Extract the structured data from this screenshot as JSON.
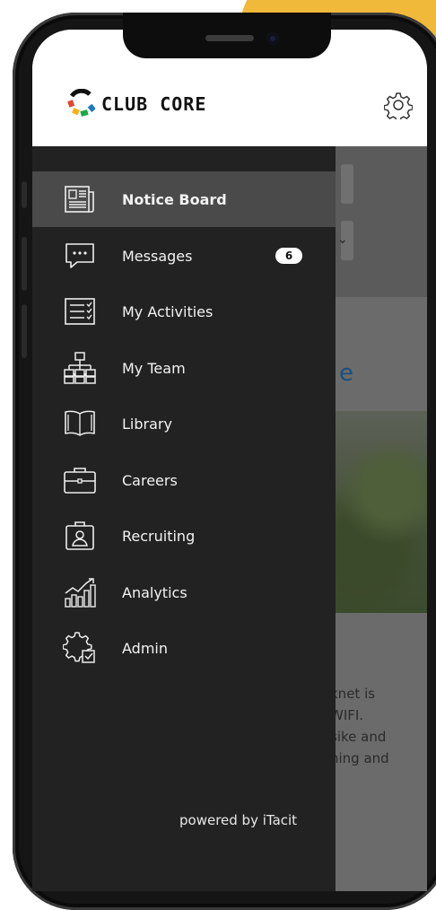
{
  "app": {
    "name": "CLUB CORE",
    "brand_colors": [
      "#e8432e",
      "#f6b21a",
      "#1ea84a",
      "#1a78c9"
    ]
  },
  "header": {
    "settings_icon": "gear-icon"
  },
  "menu": {
    "items": [
      {
        "label": "Notice Board",
        "icon": "newspaper-icon",
        "active": true
      },
      {
        "label": "Messages",
        "icon": "chat-bubble-icon",
        "badge": "6"
      },
      {
        "label": "My Activities",
        "icon": "checklist-icon"
      },
      {
        "label": "My Team",
        "icon": "org-chart-icon"
      },
      {
        "label": "Library",
        "icon": "open-book-icon"
      },
      {
        "label": "Careers",
        "icon": "briefcase-icon"
      },
      {
        "label": "Recruiting",
        "icon": "id-badge-icon"
      },
      {
        "label": "Analytics",
        "icon": "bar-chart-icon"
      },
      {
        "label": "Admin",
        "icon": "admin-gear-icon"
      }
    ],
    "footer": "powered by iTacit"
  },
  "background": {
    "heading_fragment": "e",
    "text_lines": [
      "knet is",
      "WIFI.",
      "sike and",
      "hing and"
    ]
  },
  "colors": {
    "drawer_bg": "#222222",
    "active_item_bg": "#4a4a4a",
    "accent_yellow": "#f0b93a"
  }
}
